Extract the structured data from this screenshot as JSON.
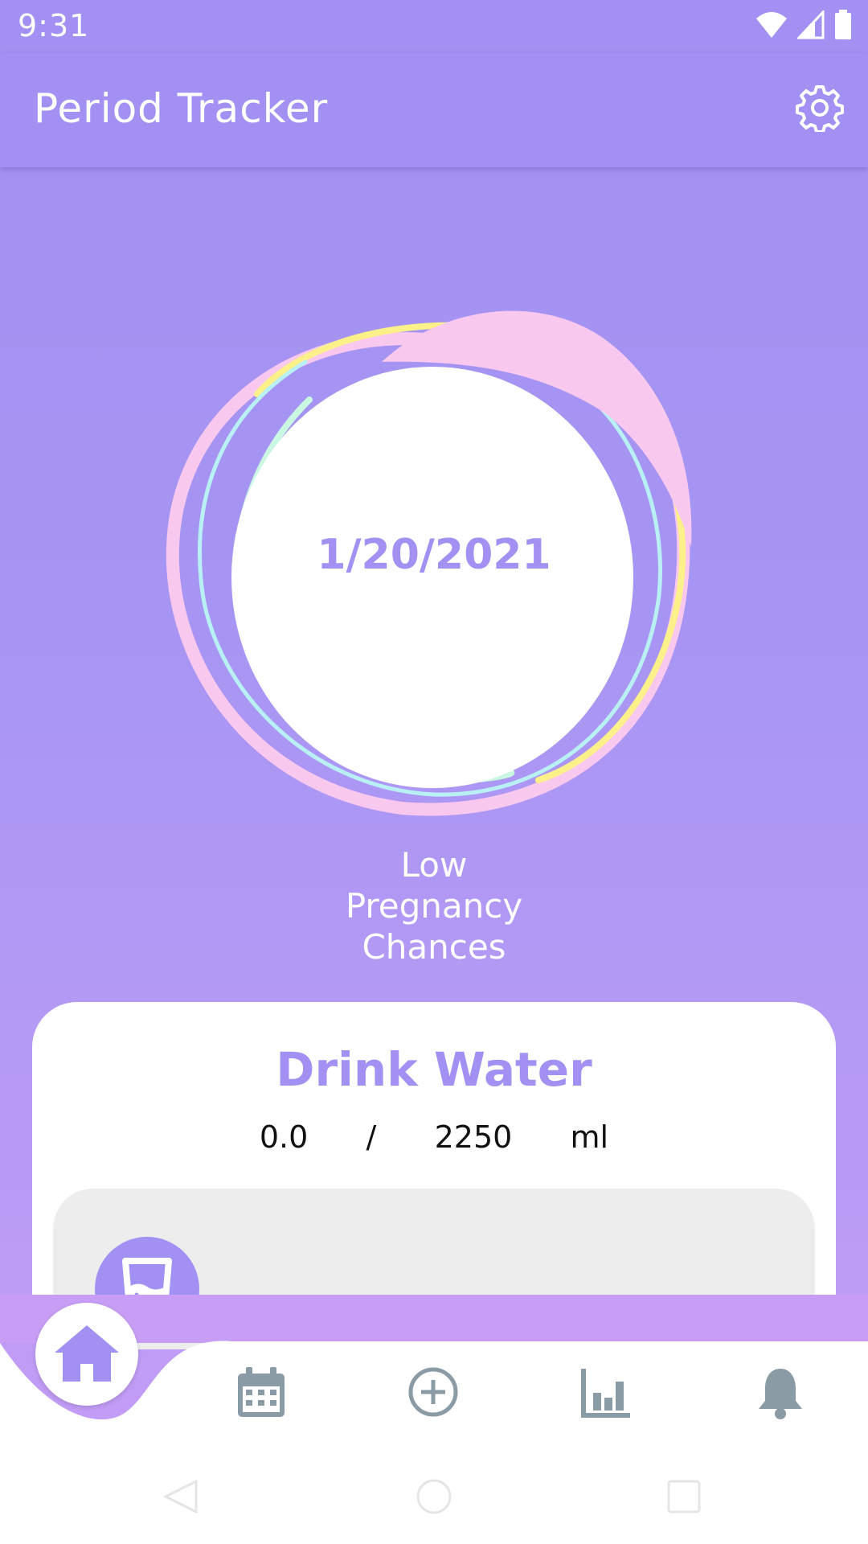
{
  "status_bar": {
    "time": "9:31"
  },
  "app_bar": {
    "title": "Period Tracker"
  },
  "cycle": {
    "date": "1/20/2021",
    "pregnancy_chance": "Low\nPregnancy\nChances"
  },
  "water": {
    "title": "Drink Water",
    "amount": "0.0   /   2250   ml"
  },
  "bottom_nav": {
    "items": [
      "home-icon",
      "calendar-icon",
      "add-circle-icon",
      "bar-chart-icon",
      "bell-icon"
    ]
  },
  "colors": {
    "accent": "#A291F2",
    "ring_pink": "#F9C8EE",
    "ring_yellow": "#FBF08A",
    "ring_cyan": "#B9F0F4",
    "ring_mint": "#C9F7E2",
    "nav_grey": "#8A9BA6"
  }
}
